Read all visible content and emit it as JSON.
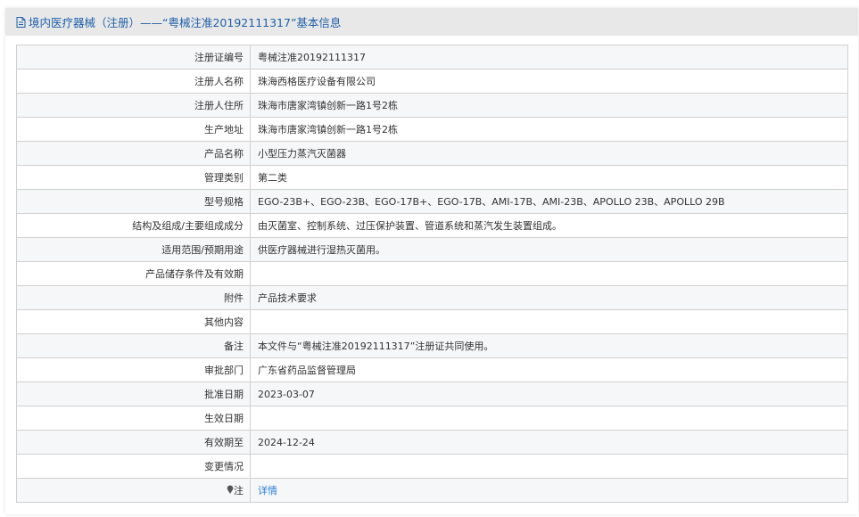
{
  "header": {
    "title": "境内医疗器械（注册）——“粤械注准20192111317”基本信息"
  },
  "rows": [
    {
      "label": "注册证编号",
      "value": "粤械注准20192111317"
    },
    {
      "label": "注册人名称",
      "value": "珠海西格医疗设备有限公司"
    },
    {
      "label": "注册人住所",
      "value": "珠海市唐家湾镇创新一路1号2栋"
    },
    {
      "label": "生产地址",
      "value": "珠海市唐家湾镇创新一路1号2栋"
    },
    {
      "label": "产品名称",
      "value": "小型压力蒸汽灭菌器"
    },
    {
      "label": "管理类别",
      "value": "第二类"
    },
    {
      "label": "型号规格",
      "value": "EGO-23B+、EGO-23B、EGO-17B+、EGO-17B、AMI-17B、AMI-23B、APOLLO 23B、APOLLO 29B"
    },
    {
      "label": "结构及组成/主要组成成分",
      "value": "由灭菌室、控制系统、过压保护装置、管道系统和蒸汽发生装置组成。"
    },
    {
      "label": "适用范围/预期用途",
      "value": "供医疗器械进行湿热灭菌用。"
    },
    {
      "label": "产品储存条件及有效期",
      "value": ""
    },
    {
      "label": "附件",
      "value": "产品技术要求"
    },
    {
      "label": "其他内容",
      "value": ""
    },
    {
      "label": "备注",
      "value": "本文件与“粤械注准20192111317”注册证共同使用。"
    },
    {
      "label": "审批部门",
      "value": "广东省药品监督管理局"
    },
    {
      "label": "批准日期",
      "value": "2023-03-07"
    },
    {
      "label": "生效日期",
      "value": ""
    },
    {
      "label": "有效期至",
      "value": "2024-12-24"
    },
    {
      "label": "变更情况",
      "value": ""
    }
  ],
  "note": {
    "label": "注",
    "link": "详情"
  }
}
